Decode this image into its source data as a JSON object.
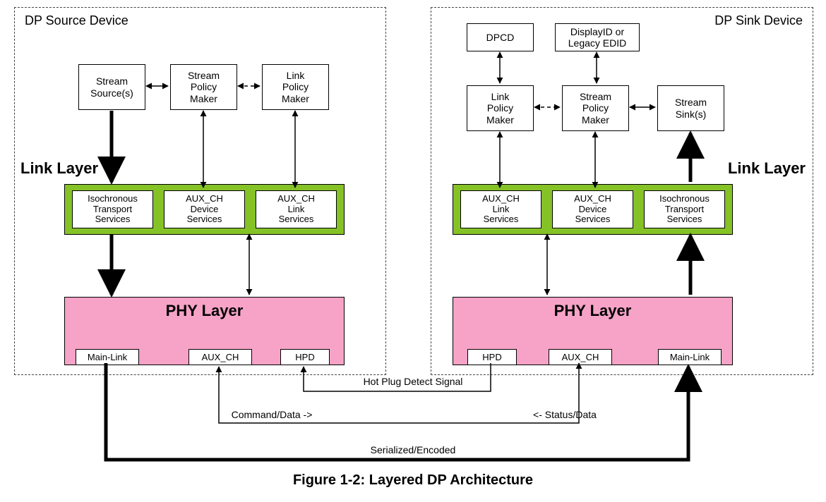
{
  "source": {
    "title": "DP Source Device",
    "link_layer_label": "Link Layer",
    "top_boxes": {
      "stream_source": "Stream\nSource(s)",
      "stream_policy": "Stream\nPolicy\nMaker",
      "link_policy": "Link\nPolicy\nMaker"
    },
    "green": {
      "iso": "Isochronous\nTransport\nServices",
      "aux_dev": "AUX_CH\nDevice\nServices",
      "aux_link": "AUX_CH\nLink\nServices"
    },
    "phy": {
      "title": "PHY Layer",
      "main_link": "Main-Link",
      "aux_ch": "AUX_CH",
      "hpd": "HPD"
    }
  },
  "sink": {
    "title": "DP Sink Device",
    "link_layer_label": "Link Layer",
    "extra_top": {
      "dpcd": "DPCD",
      "edid": "DisplayID or\nLegacy EDID"
    },
    "top_boxes": {
      "link_policy": "Link\nPolicy\nMaker",
      "stream_policy": "Stream\nPolicy\nMaker",
      "stream_sink": "Stream\nSink(s)"
    },
    "green": {
      "aux_link": "AUX_CH\nLink\nServices",
      "aux_dev": "AUX_CH\nDevice\nServices",
      "iso": "Isochronous\nTransport\nServices"
    },
    "phy": {
      "title": "PHY Layer",
      "hpd": "HPD",
      "aux_ch": "AUX_CH",
      "main_link": "Main-Link"
    }
  },
  "signals": {
    "hpd": "Hot Plug Detect Signal",
    "command": "Command/Data ->",
    "status": "<- Status/Data",
    "serialized": "Serialized/Encoded"
  },
  "caption": "Figure 1-2: Layered DP Architecture"
}
